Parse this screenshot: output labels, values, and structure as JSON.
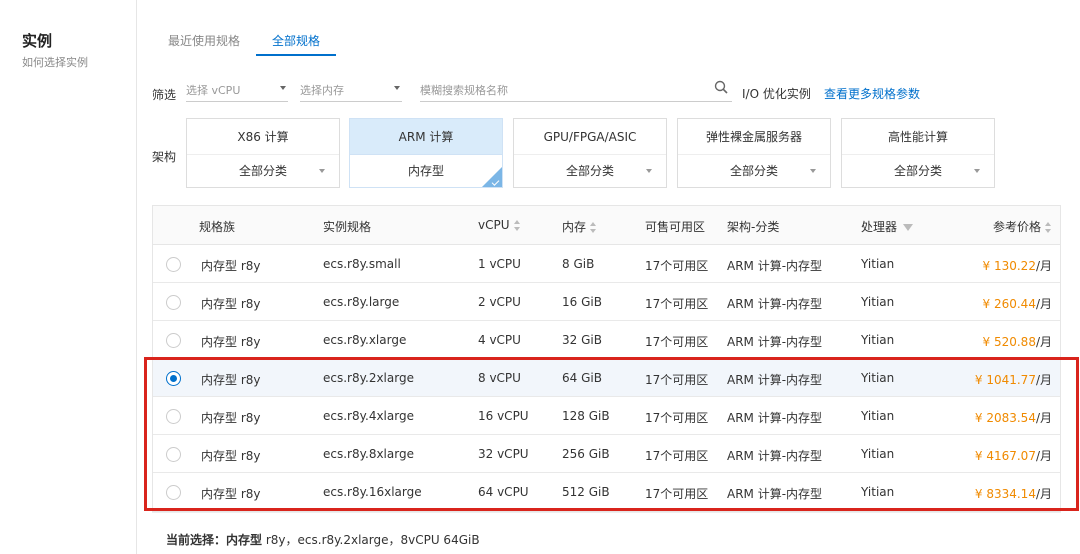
{
  "section": {
    "title": "实例",
    "subtitle": "如何选择实例"
  },
  "tabs": [
    {
      "label": "最近使用规格",
      "active": false
    },
    {
      "label": "全部规格",
      "active": true
    }
  ],
  "filters": {
    "label": "筛选",
    "vcpu_placeholder": "选择 vCPU",
    "memory_placeholder": "选择内存",
    "search_placeholder": "模糊搜索规格名称",
    "io_label": "I/O 优化实例",
    "more_link": "查看更多规格参数"
  },
  "architecture": {
    "label": "架构",
    "cards": [
      {
        "name": "X86 计算",
        "category": "全部分类",
        "active": false
      },
      {
        "name": "ARM 计算",
        "category": "内存型",
        "active": true
      },
      {
        "name": "GPU/FPGA/ASIC",
        "category": "全部分类",
        "active": false
      },
      {
        "name": "弹性裸金属服务器",
        "category": "全部分类",
        "active": false
      },
      {
        "name": "高性能计算",
        "category": "全部分类",
        "active": false
      }
    ]
  },
  "table": {
    "headers": {
      "family": "规格族",
      "spec": "实例规格",
      "vcpu": "vCPU",
      "memory": "内存",
      "zones": "可售可用区",
      "arch": "架构-分类",
      "processor": "处理器",
      "price": "参考价格"
    },
    "rows": [
      {
        "family": "内存型 r8y",
        "spec": "ecs.r8y.small",
        "vcpu": "1 vCPU",
        "memory": "8 GiB",
        "zones": "17个可用区",
        "arch": "ARM 计算-内存型",
        "processor": "Yitian",
        "price": "¥ 130.22",
        "unit": "/月",
        "selected": false
      },
      {
        "family": "内存型 r8y",
        "spec": "ecs.r8y.large",
        "vcpu": "2 vCPU",
        "memory": "16 GiB",
        "zones": "17个可用区",
        "arch": "ARM 计算-内存型",
        "processor": "Yitian",
        "price": "¥ 260.44",
        "unit": "/月",
        "selected": false
      },
      {
        "family": "内存型 r8y",
        "spec": "ecs.r8y.xlarge",
        "vcpu": "4 vCPU",
        "memory": "32 GiB",
        "zones": "17个可用区",
        "arch": "ARM 计算-内存型",
        "processor": "Yitian",
        "price": "¥ 520.88",
        "unit": "/月",
        "selected": false
      },
      {
        "family": "内存型 r8y",
        "spec": "ecs.r8y.2xlarge",
        "vcpu": "8 vCPU",
        "memory": "64 GiB",
        "zones": "17个可用区",
        "arch": "ARM 计算-内存型",
        "processor": "Yitian",
        "price": "¥ 1041.77",
        "unit": "/月",
        "selected": true
      },
      {
        "family": "内存型 r8y",
        "spec": "ecs.r8y.4xlarge",
        "vcpu": "16 vCPU",
        "memory": "128 GiB",
        "zones": "17个可用区",
        "arch": "ARM 计算-内存型",
        "processor": "Yitian",
        "price": "¥ 2083.54",
        "unit": "/月",
        "selected": false
      },
      {
        "family": "内存型 r8y",
        "spec": "ecs.r8y.8xlarge",
        "vcpu": "32 vCPU",
        "memory": "256 GiB",
        "zones": "17个可用区",
        "arch": "ARM 计算-内存型",
        "processor": "Yitian",
        "price": "¥ 4167.07",
        "unit": "/月",
        "selected": false
      },
      {
        "family": "内存型 r8y",
        "spec": "ecs.r8y.16xlarge",
        "vcpu": "64 vCPU",
        "memory": "512 GiB",
        "zones": "17个可用区",
        "arch": "ARM 计算-内存型",
        "processor": "Yitian",
        "price": "¥ 8334.14",
        "unit": "/月",
        "selected": false
      }
    ]
  },
  "summary": {
    "label": "当前选择：",
    "family": "内存型",
    "detail": " r8y，ecs.r8y.2xlarge，8vCPU 64GiB"
  },
  "colors": {
    "accent": "#0070cc",
    "price": "#f08a00",
    "highlight": "#d9241c"
  }
}
